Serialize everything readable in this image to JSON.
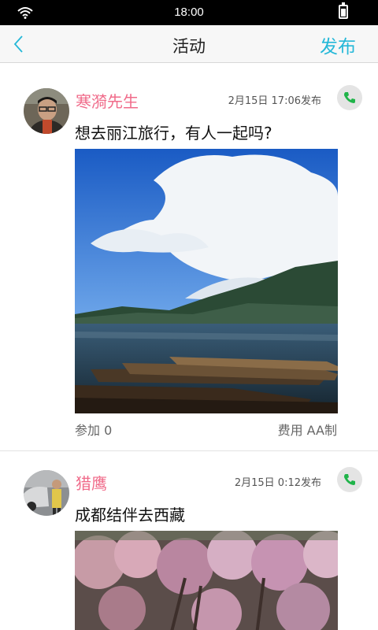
{
  "status_bar": {
    "time": "18:00",
    "icons": [
      "wifi-icon",
      "battery-icon"
    ]
  },
  "nav": {
    "back_icon": "chevron-left-icon",
    "title": "活动",
    "publish_label": "发布",
    "accent": "#25b8d8"
  },
  "colors": {
    "username": "#f06b8a",
    "call_icon": "#20b44a"
  },
  "posts": [
    {
      "username": "寒漪先生",
      "time": "2月15日 17:06发布",
      "content": "想去丽江旅行，有人一起吗?",
      "image": "lake-boats-photo",
      "join_label": "参加 0",
      "cost_label": "费用 AA制"
    },
    {
      "username": "猎鹰",
      "time": "2月15日 0:12发布",
      "content": "成都结伴去西藏",
      "image": "blossom-trees-photo"
    }
  ]
}
